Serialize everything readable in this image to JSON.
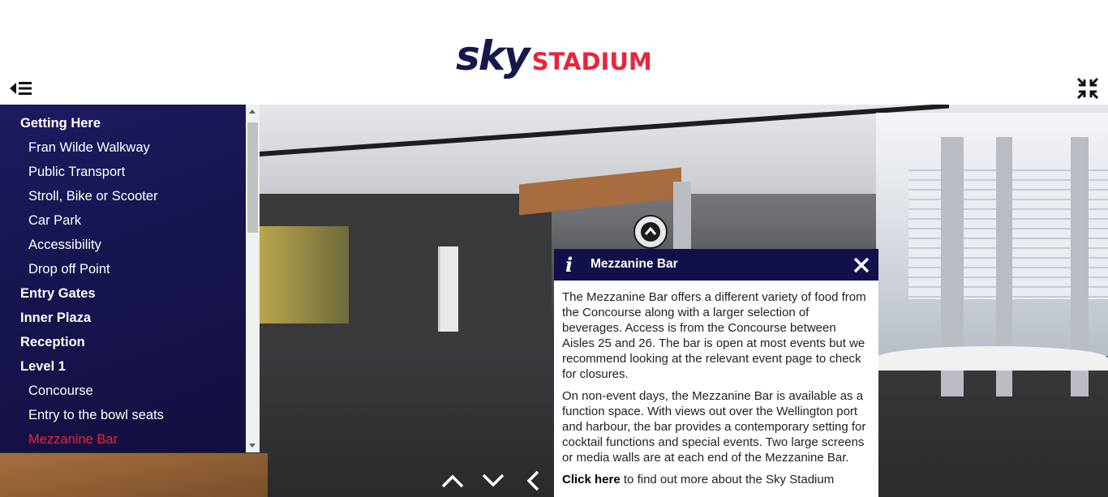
{
  "header": {
    "logo_sky": "sky",
    "logo_stadium": "STADIUM",
    "menu_icon": "menu-collapse-icon",
    "fullscreen_icon": "fullscreen-exit-icon"
  },
  "colors": {
    "brand_navy": "#14184d",
    "brand_red": "#e8253c",
    "sidebar_bg": "#16144d",
    "active_item": "#e8253c"
  },
  "sidebar": {
    "items": [
      {
        "label": "Getting Here",
        "type": "section"
      },
      {
        "label": "Fran Wilde Walkway",
        "type": "sub"
      },
      {
        "label": "Public Transport",
        "type": "sub"
      },
      {
        "label": "Stroll, Bike or Scooter",
        "type": "sub"
      },
      {
        "label": "Car Park",
        "type": "sub"
      },
      {
        "label": "Accessibility",
        "type": "sub"
      },
      {
        "label": "Drop off Point",
        "type": "sub"
      },
      {
        "label": "Entry Gates",
        "type": "section"
      },
      {
        "label": "Inner Plaza",
        "type": "section"
      },
      {
        "label": "Reception",
        "type": "section"
      },
      {
        "label": "Level 1",
        "type": "section"
      },
      {
        "label": "Concourse",
        "type": "sub"
      },
      {
        "label": "Entry to the bowl seats",
        "type": "sub"
      },
      {
        "label": "Mezzanine Bar",
        "type": "sub",
        "active": true
      }
    ]
  },
  "popup": {
    "info_icon": "i",
    "title": "Mezzanine Bar",
    "paragraph1": "The Mezzanine Bar offers a different variety of food from the Concourse along with a larger selection of beverages. Access is from the Concourse between Aisles 25 and 26. The bar is open at most events but we recommend looking at the relevant event page to check for closures.",
    "paragraph2": "On non-event days, the Mezzanine Bar is available as a function space. With views out over the Wellington port and harbour, the bar provides a contemporary setting for cocktail functions and special events. Two large screens or media walls are at each end of the Mezzanine Bar.",
    "link_text": "Click here",
    "paragraph3_rest": " to find out more about the Sky Stadium"
  },
  "nav": {
    "up_icon": "chevron-up-icon",
    "down_icon": "chevron-down-icon",
    "left_icon": "chevron-left-icon"
  }
}
